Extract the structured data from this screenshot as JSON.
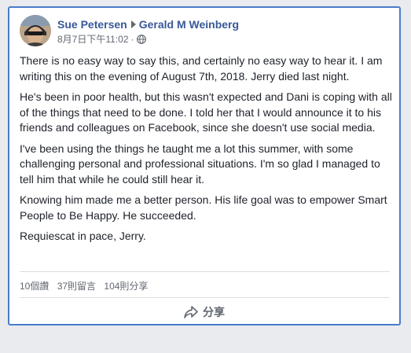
{
  "post": {
    "author": "Sue Petersen",
    "target": "Gerald M Weinberg",
    "timestamp": "8月7日下午11:02",
    "separator": "·",
    "privacy_icon": "globe-icon",
    "paragraphs": [
      "There is no easy way to say this, and certainly no easy way to hear it. I am writing this on the evening of August 7th, 2018. Jerry died last night.",
      "He's been in poor health, but this wasn't expected and Dani is coping with all of the things that need to be done. I told her that I would announce it to his friends and colleagues on Facebook, since she doesn't use social media.",
      "I've been using the things he taught me a lot this summer, with some challenging personal and professional situations. I'm so glad I managed to tell him that while he could still hear it.",
      "Knowing him made me a better person. His life goal was to empower Smart People to Be Happy. He succeeded.",
      "Requiescat in pace, Jerry."
    ]
  },
  "stats": {
    "reactions": "10個讚",
    "comments": "37則留言",
    "shares": "104則分享"
  },
  "actions": {
    "share_label": "分享",
    "share_icon": "share-arrow-icon"
  },
  "colors": {
    "link": "#385898",
    "border": "#4a7cc7",
    "background": "#e9ebee"
  }
}
